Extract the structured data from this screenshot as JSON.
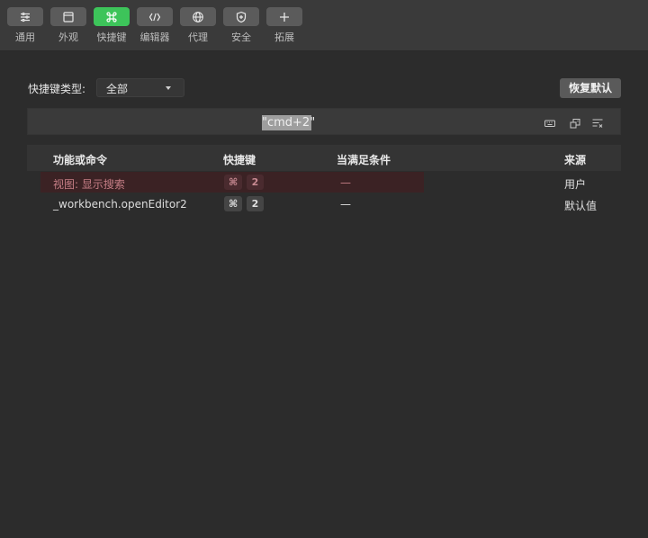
{
  "toolbar": {
    "items": [
      {
        "label": "通用",
        "icon": "list-settings-icon"
      },
      {
        "label": "外观",
        "icon": "window-icon"
      },
      {
        "label": "快捷键",
        "icon": "command-icon",
        "active": true
      },
      {
        "label": "编辑器",
        "icon": "code-icon"
      },
      {
        "label": "代理",
        "icon": "globe-icon"
      },
      {
        "label": "安全",
        "icon": "shield-icon"
      },
      {
        "label": "拓展",
        "icon": "plus-icon"
      }
    ]
  },
  "filter": {
    "type_label": "快捷键类型:",
    "type_value": "全部",
    "restore_label": "恢复默认"
  },
  "search": {
    "value": "\"cmd+2\"",
    "icons": [
      "keyboard-icon",
      "sort-icon",
      "clear-filter-icon"
    ]
  },
  "table": {
    "headers": {
      "command": "功能或命令",
      "keybinding": "快捷键",
      "when": "当满足条件",
      "source": "来源"
    },
    "rows": [
      {
        "command": "视图: 显示搜索",
        "keys": [
          "⌘",
          "2"
        ],
        "when": "—",
        "source": "用户"
      },
      {
        "command": "_workbench.openEditor2",
        "keys": [
          "⌘",
          "2"
        ],
        "when": "—",
        "source": "默认值"
      }
    ]
  },
  "colors": {
    "accent": "#3dc45a",
    "user_row_text": "#c67e86",
    "user_row_bg": "#3b2224"
  }
}
